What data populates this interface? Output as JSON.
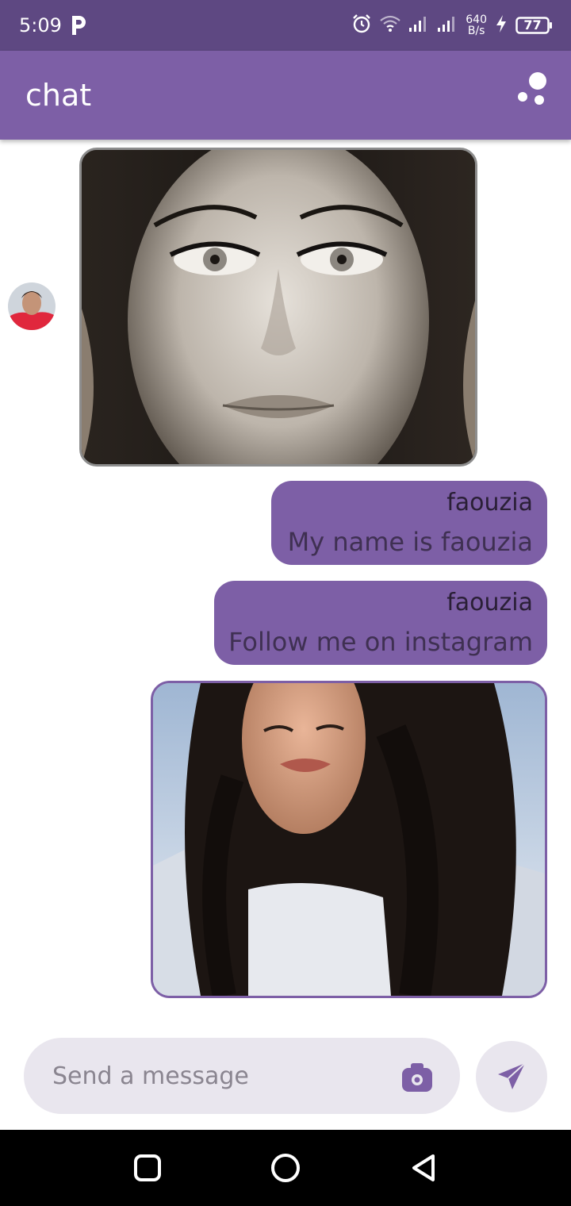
{
  "status_bar": {
    "time": "5:09",
    "speed_value": "640",
    "speed_unit": "B/s",
    "battery": "77",
    "icons": [
      "p-icon",
      "alarm-icon",
      "wifi-icon",
      "signal-icon",
      "signal-icon",
      "charging-icon",
      "battery-icon"
    ]
  },
  "app_bar": {
    "title": "chat",
    "menu_icon": "dots-menu-icon"
  },
  "messages": [
    {
      "type": "image",
      "subject": "portrait-photo",
      "avatar": "contact-avatar"
    },
    {
      "type": "text",
      "sender": "faouzia",
      "text": "My name is faouzia"
    },
    {
      "type": "text",
      "sender": "faouzia",
      "text": "Follow me on instagram"
    },
    {
      "type": "image",
      "subject": "selfie-photo"
    }
  ],
  "composer": {
    "placeholder": "Send a message",
    "attach_icon": "camera-icon",
    "send_icon": "send-icon"
  },
  "nav_bar": {
    "buttons": [
      "recents-button",
      "home-button",
      "back-button"
    ]
  },
  "colors": {
    "status_bar": "#5e4882",
    "accent": "#7d5fa6",
    "composer_bg": "#e9e6ee"
  }
}
